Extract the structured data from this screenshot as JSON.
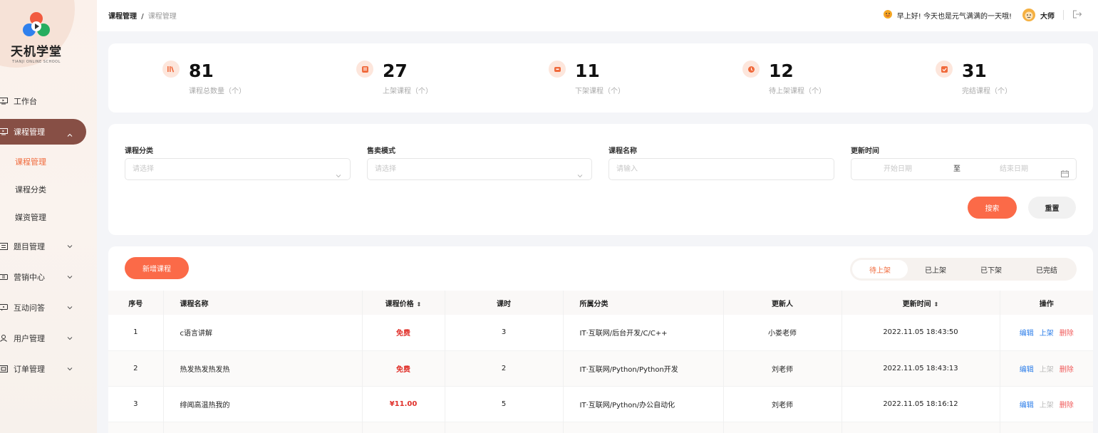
{
  "brand": {
    "name": "天机学堂",
    "sub": "TIANJI ONLINE SCHOOL"
  },
  "menu": [
    {
      "label": "工作台",
      "icon": "monitor-icon",
      "expand": false
    },
    {
      "label": "课程管理",
      "icon": "course-icon",
      "active": true
    },
    {
      "label": "题目管理",
      "icon": "exam-icon"
    },
    {
      "label": "营销中心",
      "icon": "ticket-icon"
    },
    {
      "label": "互动问答",
      "icon": "chat-icon"
    },
    {
      "label": "用户管理",
      "icon": "user-icon"
    },
    {
      "label": "订单管理",
      "icon": "order-icon"
    }
  ],
  "submenu": [
    {
      "label": "课程管理",
      "current": true
    },
    {
      "label": "课程分类"
    },
    {
      "label": "媒资管理"
    }
  ],
  "header": {
    "crumb1": "课程管理",
    "sep": "/",
    "crumb2": "课程管理",
    "greeting": "早上好! 今天也是元气满满的一天哦!",
    "username": "大师"
  },
  "stats": [
    {
      "value": "81",
      "label": "课程总数量（个）",
      "icon": "books-icon"
    },
    {
      "value": "27",
      "label": "上架课程（个）",
      "icon": "up-icon"
    },
    {
      "value": "11",
      "label": "下架课程（个）",
      "icon": "down-icon"
    },
    {
      "value": "12",
      "label": "待上架课程（个）",
      "icon": "clock-icon"
    },
    {
      "value": "31",
      "label": "完结课程（个）",
      "icon": "check-icon"
    }
  ],
  "filters": {
    "category": {
      "label": "课程分类",
      "placeholder": "请选择"
    },
    "mode": {
      "label": "售卖模式",
      "placeholder": "请选择"
    },
    "name": {
      "label": "课程名称",
      "placeholder": "请输入"
    },
    "time": {
      "label": "更新时间",
      "start": "开始日期",
      "to": "至",
      "end": "结束日期"
    },
    "search": "搜索",
    "reset": "重置"
  },
  "actions": {
    "add": "新增课程"
  },
  "tabs": [
    "待上架",
    "已上架",
    "已下架",
    "已完结"
  ],
  "table": {
    "headers": [
      "序号",
      "课程名称",
      "课程价格",
      "课时",
      "所属分类",
      "更新人",
      "更新时间",
      "操作"
    ],
    "sort_glyph": "⇕",
    "rows": [
      {
        "no": "1",
        "name": "c语言讲解",
        "price": "免费",
        "hours": "3",
        "category": "IT·互联网/后台开发/C/C++",
        "updater": "小娄老师",
        "time": "2022.11.05 18:43:50",
        "edit": "编辑",
        "up": "上架",
        "del": "删除"
      },
      {
        "no": "2",
        "name": "热发热发热发热",
        "price": "免费",
        "hours": "2",
        "category": "IT·互联网/Python/Python开发",
        "updater": "刘老师",
        "time": "2022.11.05 18:43:13",
        "edit": "编辑",
        "up": "上架",
        "del": "删除"
      },
      {
        "no": "3",
        "name": "绯闻高温热我的",
        "price": "¥11.00",
        "hours": "5",
        "category": "IT·互联网/Python/办公自动化",
        "updater": "刘老师",
        "time": "2022.11.05 18:16:12",
        "edit": "编辑",
        "up": "上架",
        "del": "删除"
      }
    ]
  },
  "colors": {
    "accent": "#fb6a48",
    "menu_active": "#874f45",
    "link": "#2b7de9",
    "danger": "#f05a5a"
  }
}
